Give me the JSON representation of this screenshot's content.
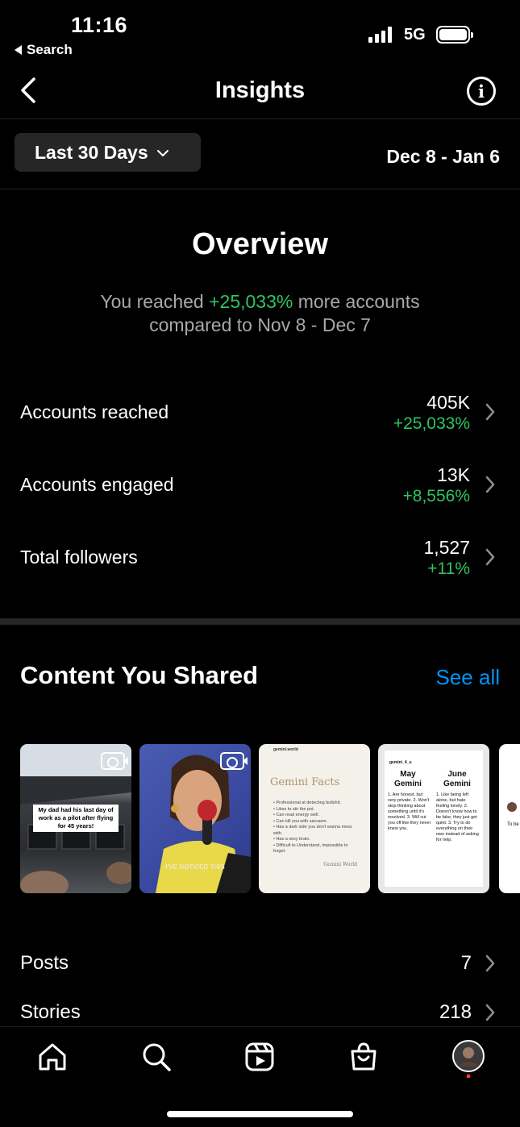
{
  "status": {
    "time": "11:16",
    "back_label": "Search",
    "network": "5G"
  },
  "nav": {
    "title": "Insights"
  },
  "filter": {
    "range_label": "Last 30 Days",
    "date_range": "Dec 8 - Jan 6"
  },
  "overview": {
    "title": "Overview",
    "desc_prefix": "You reached ",
    "desc_change": "+25,033%",
    "desc_suffix": " more accounts",
    "desc_line2": "compared to Nov 8 - Dec 7"
  },
  "metrics": [
    {
      "label": "Accounts reached",
      "value": "405K",
      "change": "+25,033%"
    },
    {
      "label": "Accounts engaged",
      "value": "13K",
      "change": "+8,556%"
    },
    {
      "label": "Total followers",
      "value": "1,527",
      "change": "+11%"
    }
  ],
  "content": {
    "title": "Content You Shared",
    "see_all": "See all",
    "thumbs": [
      {
        "caption": "My dad had his last day of work as a pilot after flying for 45 years!"
      },
      {
        "caption": "I'VE NOTICED THIS"
      },
      {
        "brand": "gemini.world",
        "heading": "Gemini Facts",
        "lines": [
          "• Professional at detecting bullshit.",
          "• Likes to stir the pot.",
          "• Can read energy well.",
          "• Can kill you with sarcasm.",
          "• Has a dark side you don't wanna mess with.",
          "• Has a sexy brain.",
          "• Difficult to Understand, impossible to forget."
        ],
        "footer": "Gemini World"
      },
      {
        "brand": "gemini_4_u",
        "col1_title": "May Gemini",
        "col2_title": "June Gemini",
        "col1": "1. Are honest, but very private. 2. Won't stop thinking about something until it's resolved. 3. Will cut you off like they never knew you.",
        "col2": "1. Like being left alone, but hate feeling lonely. 2. Doesn't know how to be fake, they just get quiet. 3. Try to do everything on their own instead of asking for help."
      },
      {
        "snippet": "To be unde"
      }
    ]
  },
  "stats": [
    {
      "label": "Posts",
      "value": "7"
    },
    {
      "label": "Stories",
      "value": "218"
    }
  ],
  "tabs": [
    "home-icon",
    "search-icon",
    "reels-icon",
    "shop-icon",
    "profile-avatar"
  ],
  "colors": {
    "positive": "#2ec462",
    "link": "#0095f6",
    "muted": "#a8a8a8",
    "surface": "#262626"
  }
}
